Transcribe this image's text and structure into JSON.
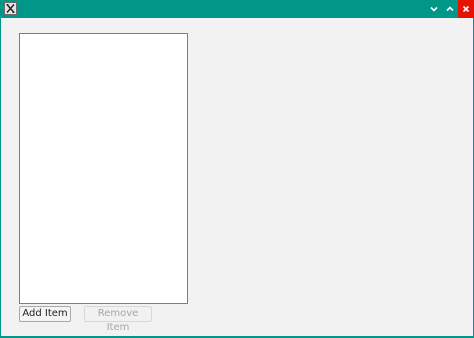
{
  "window": {
    "titlebar_color": "#009688",
    "close_color": "#e51400",
    "app_icon": "x-app-icon",
    "controls": [
      "chevron-down-icon",
      "chevron-up-icon",
      "close-icon"
    ]
  },
  "list": {
    "items": [],
    "border_color": "#1ba1d1"
  },
  "buttons": {
    "add_label": "Add Item",
    "remove_label": "Remove Item",
    "remove_enabled": false
  }
}
